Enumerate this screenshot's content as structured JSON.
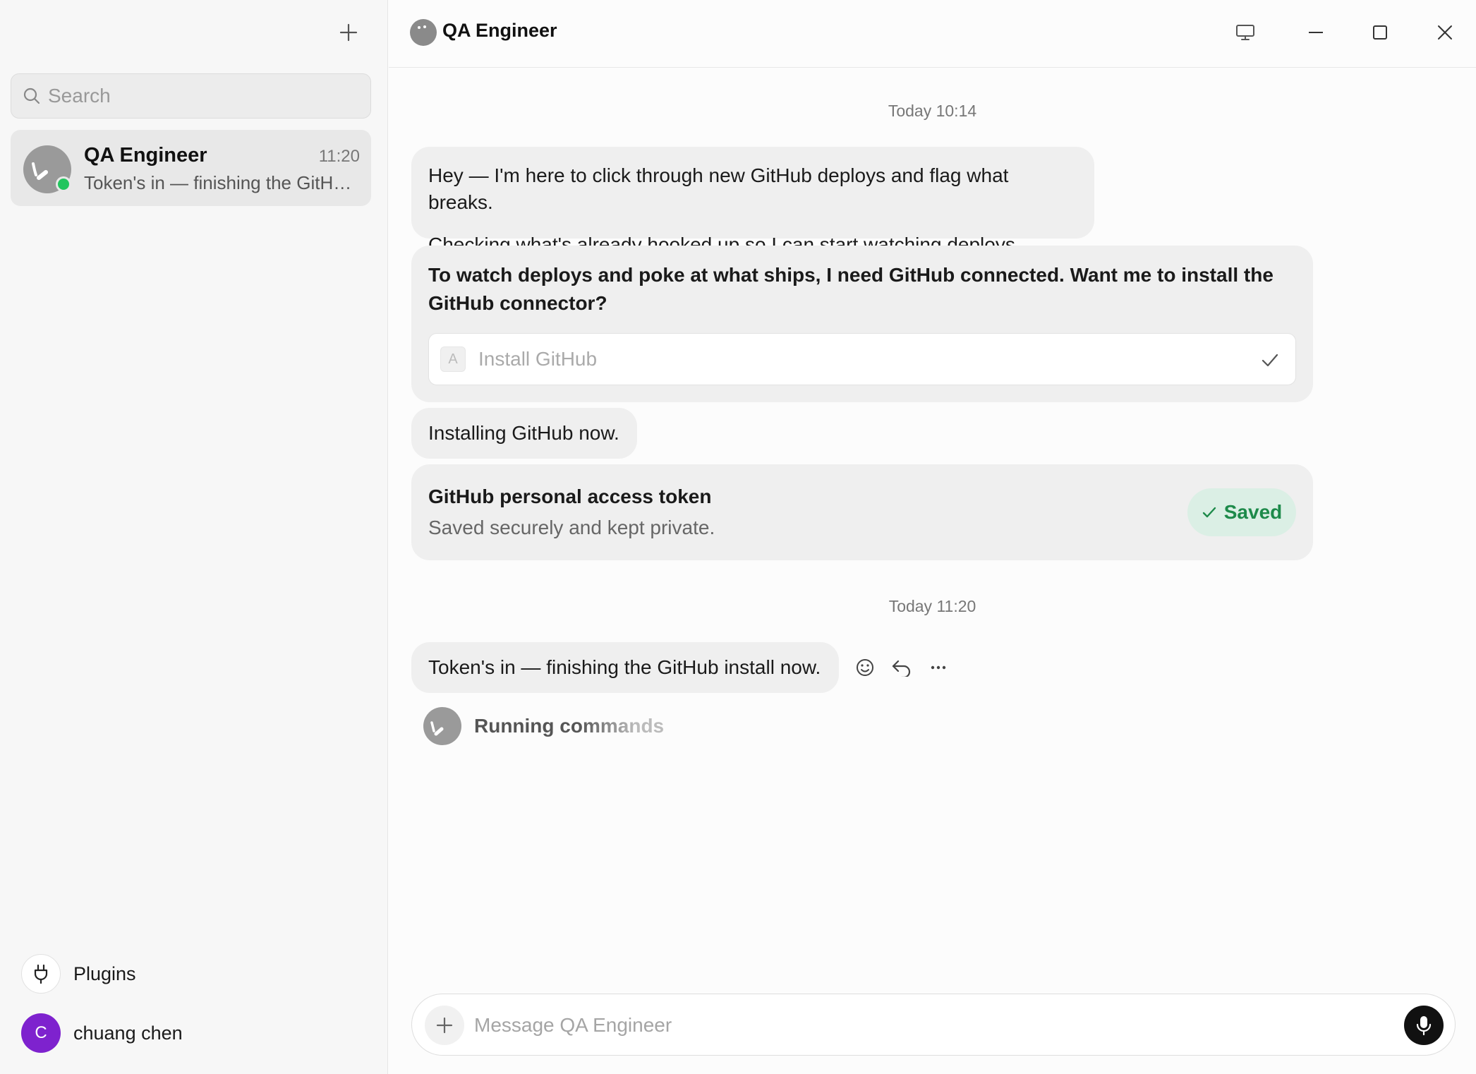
{
  "sidebar": {
    "new_chat_icon": "plus-icon",
    "search": {
      "placeholder": "Search",
      "value": ""
    },
    "conversations": [
      {
        "name": "QA Engineer",
        "time": "11:20",
        "preview": "Token's in — finishing the GitHub install now.",
        "status": "online",
        "status_color": "#22c55e"
      }
    ],
    "plugins_label": "Plugins",
    "user": {
      "initial": "C",
      "name": "chuang chen",
      "avatar_color": "#7e22ce"
    }
  },
  "header": {
    "title": "QA Engineer",
    "icons": [
      "monitor-icon",
      "minimize-icon",
      "maximize-icon",
      "close-icon"
    ]
  },
  "chat": {
    "timestamp_1": "Today 10:14",
    "message_1": {
      "line_1": "Hey — I'm here to click through new GitHub deploys and flag what breaks.",
      "line_2": "Checking what's already hooked up so I can start watching deploys."
    },
    "question": {
      "text": "To watch deploys and poke at what ships, I need GitHub connected. Want me to install the GitHub connector?",
      "option_key": "A",
      "option_label": "Install GitHub"
    },
    "message_2": "Installing GitHub now.",
    "token_card": {
      "title": "GitHub personal access token",
      "subtitle": "Saved securely and kept private.",
      "badge": "Saved",
      "badge_color": "#1d8a4a"
    },
    "timestamp_2": "Today 11:20",
    "message_3": "Token's in — finishing the GitHub install now.",
    "message_actions": [
      "emoji-icon",
      "reply-icon",
      "more-icon"
    ],
    "running_label": "Running commands"
  },
  "composer": {
    "placeholder": "Message QA Engineer",
    "value": ""
  }
}
